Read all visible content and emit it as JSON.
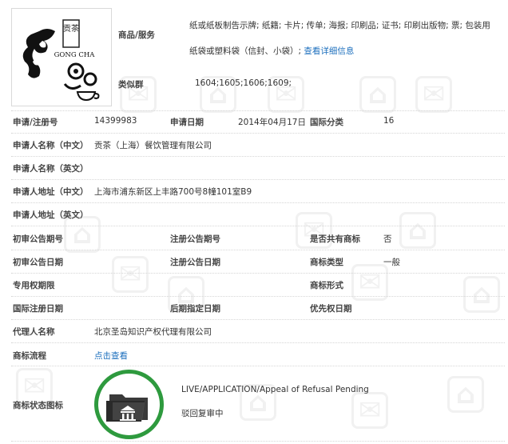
{
  "goods": {
    "label": "商品/服务",
    "text": "纸或纸板制告示牌; 纸籍; 卡片; 传单; 海报; 印刷品; 证书; 印刷出版物; 票; 包装用纸袋或塑料袋（信封、小袋）;",
    "link": "查看详细信息"
  },
  "similar": {
    "label": "类似群",
    "value": "1604;1605;1606;1609;"
  },
  "logo": {
    "text_top": "贡茶",
    "text_en": "GONG CHA"
  },
  "row1": {
    "reg_no_label": "申请/注册号",
    "reg_no": "14399983",
    "date_label": "申请日期",
    "date": "2014年04月17日",
    "class_label": "国际分类",
    "class": "16"
  },
  "applicant_cn": {
    "label": "申请人名称（中文）",
    "value": "贡茶（上海）餐饮管理有限公司"
  },
  "applicant_en": {
    "label": "申请人名称（英文）",
    "value": ""
  },
  "address_cn": {
    "label": "申请人地址（中文）",
    "value": "上海市浦东新区上丰路700号8幢101室B9"
  },
  "address_en": {
    "label": "申请人地址（英文）",
    "value": ""
  },
  "row_prelim_no": {
    "l1": "初审公告期号",
    "v1": "",
    "l2": "注册公告期号",
    "v2": "",
    "l3": "是否共有商标",
    "v3": "否"
  },
  "row_prelim_date": {
    "l1": "初审公告日期",
    "v1": "",
    "l2": "注册公告日期",
    "v2": "",
    "l3": "商标类型",
    "v3": "一般"
  },
  "row_exclusive": {
    "l1": "专用权期限",
    "v1": "",
    "l3": "商标形式",
    "v3": ""
  },
  "row_intl": {
    "l1": "国际注册日期",
    "l2": "后期指定日期",
    "l3": "优先权日期"
  },
  "agent": {
    "label": "代理人名称",
    "value": "北京圣岛知识产权代理有限公司"
  },
  "process": {
    "label": "商标流程",
    "link": "点击查看"
  },
  "status": {
    "label": "商标状态图标",
    "en": "LIVE/APPLICATION/Appeal of Refusal Pending",
    "cn": "驳回复审中",
    "color": "#2e9a3e",
    "icon": "folder-courthouse-icon"
  },
  "watermark": {
    "char": "标"
  }
}
